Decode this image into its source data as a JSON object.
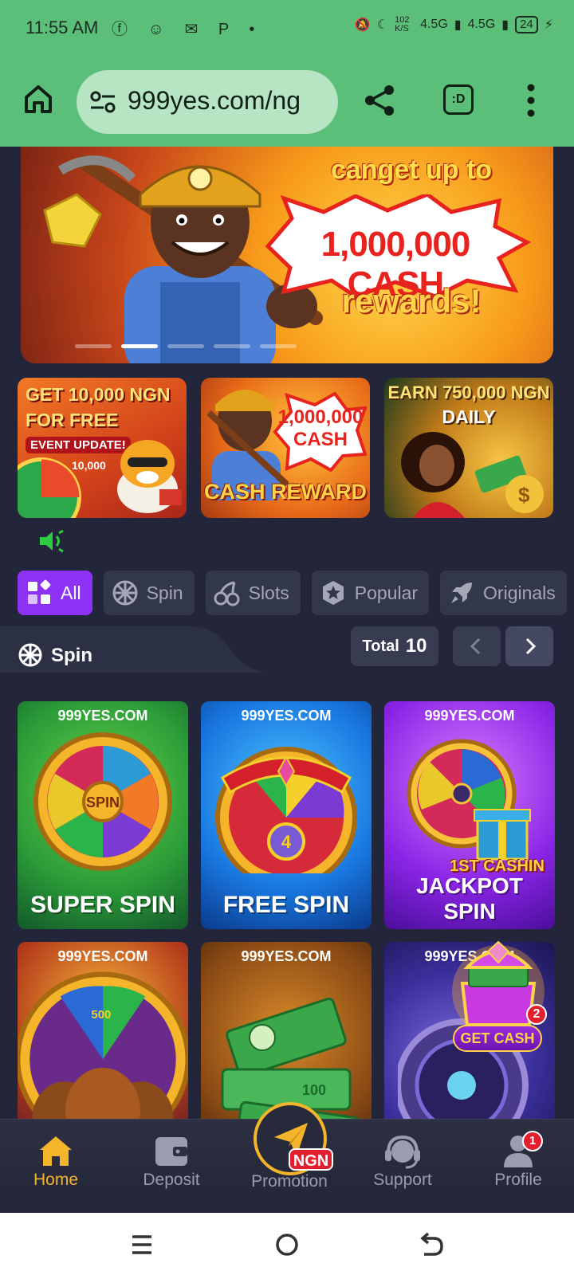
{
  "status_bar": {
    "time": "11:55 AM",
    "speed": "102 K/S",
    "net1": "4.5G",
    "net2": "4.5G",
    "battery": "24"
  },
  "browser": {
    "url": "999yes.com/ng",
    "tabs_label": ":D"
  },
  "hero": {
    "line1": "canget up to",
    "line2": "1,000,000 CASH",
    "line3": "rewards!",
    "slides": 5,
    "active_slide": 2
  },
  "promos": [
    {
      "line1": "GET 10,000 NGN",
      "line2": "FOR FREE",
      "tag": "EVENT UPDATE!",
      "small": "10,000"
    },
    {
      "line1": "1,000,000",
      "line2": "CASH",
      "line3": "CASH REWARD"
    },
    {
      "line1": "EARN 750,000 NGN",
      "line2": "DAILY"
    }
  ],
  "categories": [
    {
      "label": "All",
      "icon": "grid-icon",
      "active": true
    },
    {
      "label": "Spin",
      "icon": "wheel-icon",
      "active": false
    },
    {
      "label": "Slots",
      "icon": "cherry-icon",
      "active": false
    },
    {
      "label": "Popular",
      "icon": "star-icon",
      "active": false
    },
    {
      "label": "Originals",
      "icon": "rocket-icon",
      "active": false
    }
  ],
  "section": {
    "title": "Spin",
    "total_label": "Total",
    "total_value": "10"
  },
  "games": [
    {
      "brand": "999YES.COM",
      "name": "SUPER SPIN"
    },
    {
      "brand": "999YES.COM",
      "name": "FREE SPIN"
    },
    {
      "brand": "999YES.COM",
      "name": "JACKPOT SPIN",
      "tag": "1ST CASHIN"
    },
    {
      "brand": "999YES.COM",
      "name": ""
    },
    {
      "brand": "999YES.COM",
      "name": ""
    },
    {
      "brand": "999YES.COM",
      "name": ""
    }
  ],
  "floating": {
    "label": "GET CASH",
    "badge": "2"
  },
  "bottom_nav": {
    "home": "Home",
    "deposit": "Deposit",
    "promotion": "Promotion",
    "promotion_badge": "NGN",
    "support": "Support",
    "profile": "Profile",
    "profile_badge": "1"
  },
  "colors": {
    "browser_bar": "#5cbf79",
    "page_bg": "#23263a",
    "active_tab": "#8d31f4",
    "nav_active": "#f5b52a",
    "badge": "#e31e2e"
  }
}
